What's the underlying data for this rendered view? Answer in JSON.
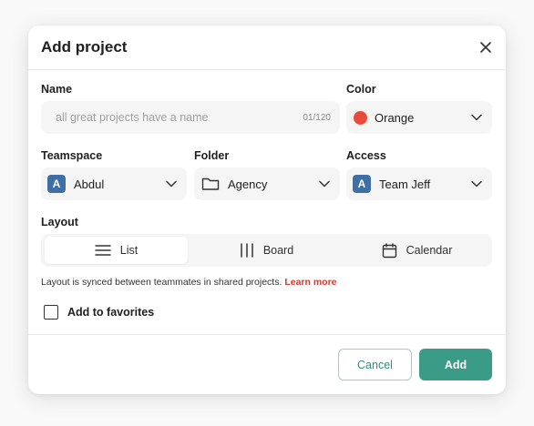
{
  "dialog": {
    "title": "Add project",
    "close_icon": "close-icon"
  },
  "name": {
    "label": "Name",
    "placeholder": "all great projects have a name",
    "counter": "01/120"
  },
  "color": {
    "label": "Color",
    "value": "Orange",
    "swatch": "#e84b3c"
  },
  "teamspace": {
    "label": "Teamspace",
    "avatar": "A",
    "value": "Abdul"
  },
  "folder": {
    "label": "Folder",
    "icon": "folder-icon",
    "value": "Agency"
  },
  "access": {
    "label": "Access",
    "avatar": "A",
    "value": "Team Jeff"
  },
  "layout": {
    "label": "Layout",
    "options": [
      {
        "label": "List",
        "icon": "list-icon",
        "active": true
      },
      {
        "label": "Board",
        "icon": "board-icon",
        "active": false
      },
      {
        "label": "Calendar",
        "icon": "calendar-icon",
        "active": false
      }
    ],
    "note": "Layout is synced between teammates in shared projects.",
    "learn_more": "Learn more"
  },
  "favorites": {
    "label": "Add to favorites",
    "checked": false
  },
  "footer": {
    "cancel_label": "Cancel",
    "add_label": "Add"
  },
  "colors": {
    "accent": "#3a9b86",
    "avatar": "#3f6fa5",
    "link": "#d6392f"
  }
}
